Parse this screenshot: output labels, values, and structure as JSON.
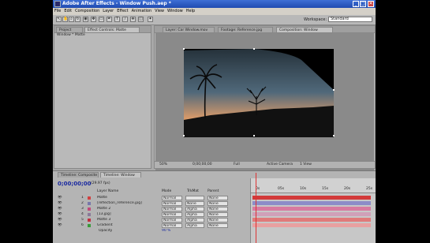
{
  "window": {
    "title": "Adobe After Effects - Window Push.aep *",
    "minimize": "_",
    "maximize": "□",
    "close": "✕"
  },
  "menu": [
    "File",
    "Edit",
    "Composition",
    "Layer",
    "Effect",
    "Animation",
    "View",
    "Window",
    "Help"
  ],
  "toolbar": {
    "workspace_label": "Workspace:",
    "workspace_value": "Standard"
  },
  "left_panel": {
    "tabs": [
      "Project",
      "Effect Controls: Matte"
    ],
    "subtitle": "Window * Matte"
  },
  "viewer": {
    "tabs": [
      "Layer: Car Window.mov",
      "Footage: Reference.jpg",
      "Composition: Window"
    ],
    "status": {
      "zoom": "50%",
      "timecode": "0;00;00;00",
      "resolution": "Full",
      "camera": "Active Camera",
      "views": "1 View"
    }
  },
  "timeline": {
    "tabs": [
      "Timeline: Composite",
      "Timeline: Window"
    ],
    "current_time": "0;00;00;00",
    "fps": "(29.97 fps)",
    "columns": {
      "layer_name": "Layer Name",
      "mode": "Mode",
      "trkmat": "TrkMat",
      "parent": "Parent"
    },
    "layers": [
      {
        "num": "1",
        "name": "Matte",
        "mode": "Normal",
        "trkmat": "",
        "parent": "None",
        "color": "#d04040",
        "bar": "#d23a3a"
      },
      {
        "num": "2",
        "name": "[reflection_reference.jpg]",
        "mode": "Normal",
        "trkmat": "None",
        "parent": "None",
        "color": "#7777aa",
        "bar": "#8c8cc8"
      },
      {
        "num": "3",
        "name": "Matte 2",
        "mode": "Normal",
        "trkmat": "Alpha",
        "parent": "None",
        "color": "#c04a7a",
        "bar": "#d77aa0"
      },
      {
        "num": "4",
        "name": "[13.jpg]",
        "mode": "Normal",
        "trkmat": "Alpha",
        "parent": "None",
        "color": "#8a7a9a",
        "bar": "#d0a0b8"
      },
      {
        "num": "5",
        "name": "Matte 3",
        "mode": "Normal",
        "trkmat": "Alpha",
        "parent": "None",
        "color": "#c03040",
        "bar": "#e07a7a"
      },
      {
        "num": "6",
        "name": "Gradient",
        "mode": "Normal",
        "trkmat": "Alpha",
        "parent": "None",
        "color": "#3a9a3a",
        "bar": "#e8a0a0"
      }
    ],
    "opacity": {
      "label": "Opacity",
      "value": "90 %"
    },
    "ruler": [
      "0s",
      "05s",
      "10s",
      "15s",
      "20s",
      "25s"
    ]
  }
}
